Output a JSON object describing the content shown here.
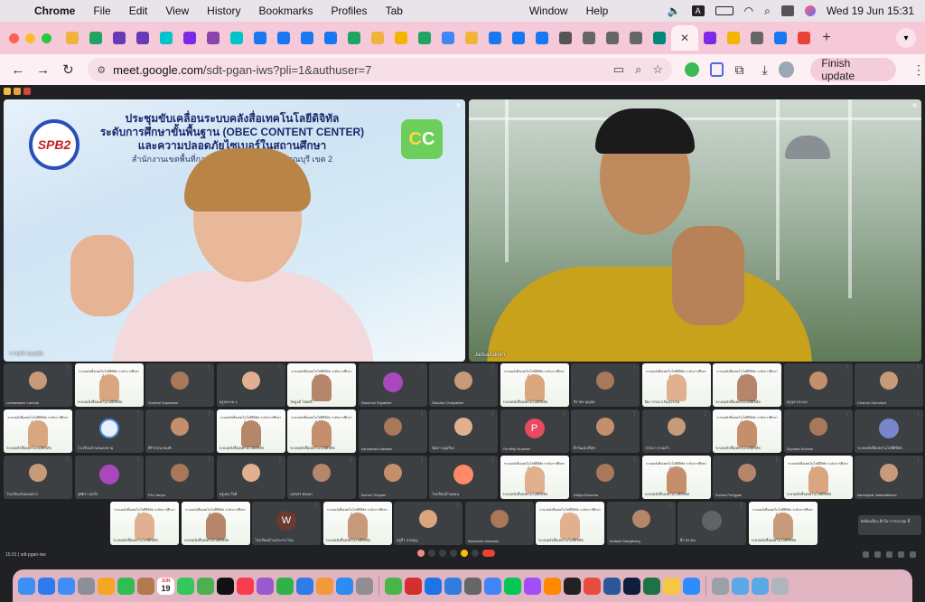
{
  "menubar": {
    "app_name": "Chrome",
    "menus": [
      "File",
      "Edit",
      "View",
      "History",
      "Bookmarks",
      "Profiles",
      "Tab",
      "Window",
      "Help"
    ],
    "date_time": "Wed 19 Jun  15:31"
  },
  "tabs": {
    "favicons": [
      {
        "icon": "google-drive-icon",
        "color": "#f2b33d"
      },
      {
        "icon": "google-drive-icon",
        "color": "#1fa463"
      },
      {
        "icon": "google-forms-icon",
        "color": "#673ab7"
      },
      {
        "icon": "google-forms-icon",
        "color": "#673ab7"
      },
      {
        "icon": "canva-icon",
        "color": "#00c4cc"
      },
      {
        "icon": "canva-icon",
        "color": "#7d2ae8"
      },
      {
        "icon": "badge-icon",
        "color": "#8e44ad"
      },
      {
        "icon": "canva-icon",
        "color": "#00c4cc"
      },
      {
        "icon": "facebook-icon",
        "color": "#1877f2"
      },
      {
        "icon": "facebook-icon",
        "color": "#1877f2"
      },
      {
        "icon": "facebook-icon",
        "color": "#1877f2"
      },
      {
        "icon": "facebook-icon",
        "color": "#1877f2"
      },
      {
        "icon": "google-drive-icon",
        "color": "#1fa463"
      },
      {
        "icon": "google-drive-icon",
        "color": "#f2b33d"
      },
      {
        "icon": "slides-icon",
        "color": "#f4b400"
      },
      {
        "icon": "google-drive-icon",
        "color": "#1fa463"
      },
      {
        "icon": "google-drive-icon",
        "color": "#4285f4"
      },
      {
        "icon": "google-drive-icon",
        "color": "#f2b33d"
      },
      {
        "icon": "facebook-icon",
        "color": "#1877f2"
      },
      {
        "icon": "facebook-icon",
        "color": "#1877f2"
      },
      {
        "icon": "facebook-icon",
        "color": "#1877f2"
      },
      {
        "icon": "download-icon",
        "color": "#555555"
      },
      {
        "icon": "globe-icon",
        "color": "#666666"
      },
      {
        "icon": "globe-icon",
        "color": "#666666"
      },
      {
        "icon": "globe-icon",
        "color": "#666666"
      },
      {
        "icon": "meet-icon",
        "color": "#00897b"
      }
    ],
    "after_active": [
      {
        "icon": "canva-icon",
        "color": "#7d2ae8"
      },
      {
        "icon": "slides-icon",
        "color": "#f4b400"
      },
      {
        "icon": "globe-icon",
        "color": "#666666"
      },
      {
        "icon": "facebook-icon",
        "color": "#1877f2"
      },
      {
        "icon": "gmail-icon",
        "color": "#ea4335"
      }
    ],
    "active_close": "✕",
    "new_tab": "+"
  },
  "toolbar": {
    "url_host": "meet.google.com",
    "url_path": "/sdt-pgan-iws?pli=1&authuser=7",
    "update_label": "Finish update"
  },
  "meet": {
    "main_left": {
      "name": "ราชศรี สมฤทัย",
      "banner_line1": "ประชุมขับเคลื่อนระบบคลังสื่อเทคโนโลยีดิจิทัล",
      "banner_line2": "ระดับการศึกษาขั้นพื้นฐาน (OBEC CONTENT CENTER)",
      "banner_line3": "และความปลอดภัยไซเบอร์ในสถานศึกษา",
      "banner_line4": "สำนักงานเขตพื้นที่การศึกษาประถมศึกษาสุพรรณบุรี เขต 2",
      "logo_text": "SPB2",
      "cc_text_1": "C",
      "cc_text_2": "C"
    },
    "main_right": {
      "name": "Jadsadakorn"
    },
    "tiles_row1": [
      "Leelawadee Lamhai",
      "ระบบคลังสื่อเทคโนโลยีดิจิทัล",
      "Sombat Supadaen",
      "ครูประถม 4",
      "ไพบูลย์ ไชยศรี",
      "Ekkachai Sayakhet",
      "Sakchai Chaiyakhet",
      "ระบบคลังสื่อเทคโนโลยีดิจิทัล",
      "จิราพร บุญสม",
      "ปิยะวรรณ กลั่นสุวรรณ",
      "ระบบคลังสื่อเทคโนโลยีดิจิทัล",
      "ครูนุช ประถม",
      "Chanon Sornvisut"
    ],
    "tiles_row2": [
      "ระบบคลังสื่อเทคโนโลยีดิจิทัล",
      "โรงเรียนบ้านหนองขาม",
      "ศิริวรรณ ทองดี",
      "ระบบคลังสื่อเทคโนโลยีดิจิทัล",
      "ระบบคลังสื่อเทคโนโลยีดิจิทัล",
      "Kanokwan Kaewsin",
      "นิตยา บุญเรือง",
      "Pornthip Nuamsri",
      "ธีรวัฒน์ ศรีสุข",
      "วรรณา ดวงแก้ว",
      "ระบบคลังสื่อเทคโนโลยีดิจิทัล",
      "Supattra Khunsri",
      "ระบบคลังสื่อเทคโนโลยีดิจิทัล"
    ],
    "tiles_row3": [
      "โรงเรียนวัดดอนตาล",
      "สุพัตรา สุขใจ",
      "Pim Janya",
      "ครูแดง ใจดี",
      "นภัสสร ทองมา",
      "Somsri Yimyam",
      "โรงเรียนบ้านดอน",
      "ระบบคลังสื่อเทคโนโลยีดิจิทัล",
      "Kittiya Boonma",
      "ระบบคลังสื่อเทคโนโลยีดิจิทัล",
      "Sunisa Pongpan",
      "ระบบคลังสื่อเทคโนโลยีดิจิทัล",
      "kamolphat Jaiswatthiwon"
    ],
    "tiles_row4": [
      "ระบบคลังสื่อเทคโนโลยีดิจิทัล",
      "ระบบคลังสื่อเทคโนโลยีดิจิทัล",
      "โรงเรียนบ้านสระกระโจม",
      "ระบบคลังสื่อเทคโนโลยีดิจิทัล",
      "ครูจิ๋ว สายบุญ",
      "Naruewan Intarasin",
      "ระบบคลังสื่อเทคโนโลยีดิจิทัล",
      "Nuttanit Sangthong",
      "อีก 59 คน",
      "ระบบคลังสื่อเทคโนโลยีดิจิทัล"
    ],
    "tile_caption": "ระบบคลังสื่อเทคโนโลยีดิจิทัล ระดับการศึกษาขั้นพื้นฐาน",
    "letters": {
      "p": "P",
      "w": "W"
    },
    "toast_text": "ยังมีคนอื่นๆ อีกใน การประชุม นี้",
    "meet_code": "15:31 | sdt-pgan-iws",
    "others_label": "อีก 59 คน"
  },
  "dock": {
    "calendar_month": "JUN",
    "calendar_day": "19",
    "badge_count": "5"
  },
  "colors": {
    "menubar": "#e9e3ea",
    "tabstrip": "#f6c9d8",
    "toolbar": "#fdf0f4",
    "meet_bg": "#202124",
    "tile_bg": "#3c4043",
    "accent_pink": "#f3cdd9",
    "p_avatar": "#e84a5f",
    "w_avatar": "#6a3a2f"
  }
}
